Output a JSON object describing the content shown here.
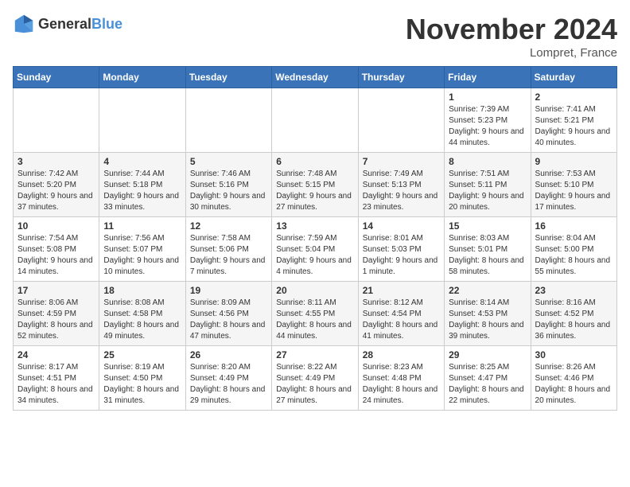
{
  "logo": {
    "text_general": "General",
    "text_blue": "Blue"
  },
  "header": {
    "month_title": "November 2024",
    "location": "Lompret, France"
  },
  "weekdays": [
    "Sunday",
    "Monday",
    "Tuesday",
    "Wednesday",
    "Thursday",
    "Friday",
    "Saturday"
  ],
  "weeks": [
    [
      {
        "day": "",
        "info": ""
      },
      {
        "day": "",
        "info": ""
      },
      {
        "day": "",
        "info": ""
      },
      {
        "day": "",
        "info": ""
      },
      {
        "day": "",
        "info": ""
      },
      {
        "day": "1",
        "info": "Sunrise: 7:39 AM\nSunset: 5:23 PM\nDaylight: 9 hours\nand 44 minutes."
      },
      {
        "day": "2",
        "info": "Sunrise: 7:41 AM\nSunset: 5:21 PM\nDaylight: 9 hours\nand 40 minutes."
      }
    ],
    [
      {
        "day": "3",
        "info": "Sunrise: 7:42 AM\nSunset: 5:20 PM\nDaylight: 9 hours\nand 37 minutes."
      },
      {
        "day": "4",
        "info": "Sunrise: 7:44 AM\nSunset: 5:18 PM\nDaylight: 9 hours\nand 33 minutes."
      },
      {
        "day": "5",
        "info": "Sunrise: 7:46 AM\nSunset: 5:16 PM\nDaylight: 9 hours\nand 30 minutes."
      },
      {
        "day": "6",
        "info": "Sunrise: 7:48 AM\nSunset: 5:15 PM\nDaylight: 9 hours\nand 27 minutes."
      },
      {
        "day": "7",
        "info": "Sunrise: 7:49 AM\nSunset: 5:13 PM\nDaylight: 9 hours\nand 23 minutes."
      },
      {
        "day": "8",
        "info": "Sunrise: 7:51 AM\nSunset: 5:11 PM\nDaylight: 9 hours\nand 20 minutes."
      },
      {
        "day": "9",
        "info": "Sunrise: 7:53 AM\nSunset: 5:10 PM\nDaylight: 9 hours\nand 17 minutes."
      }
    ],
    [
      {
        "day": "10",
        "info": "Sunrise: 7:54 AM\nSunset: 5:08 PM\nDaylight: 9 hours\nand 14 minutes."
      },
      {
        "day": "11",
        "info": "Sunrise: 7:56 AM\nSunset: 5:07 PM\nDaylight: 9 hours\nand 10 minutes."
      },
      {
        "day": "12",
        "info": "Sunrise: 7:58 AM\nSunset: 5:06 PM\nDaylight: 9 hours\nand 7 minutes."
      },
      {
        "day": "13",
        "info": "Sunrise: 7:59 AM\nSunset: 5:04 PM\nDaylight: 9 hours\nand 4 minutes."
      },
      {
        "day": "14",
        "info": "Sunrise: 8:01 AM\nSunset: 5:03 PM\nDaylight: 9 hours\nand 1 minute."
      },
      {
        "day": "15",
        "info": "Sunrise: 8:03 AM\nSunset: 5:01 PM\nDaylight: 8 hours\nand 58 minutes."
      },
      {
        "day": "16",
        "info": "Sunrise: 8:04 AM\nSunset: 5:00 PM\nDaylight: 8 hours\nand 55 minutes."
      }
    ],
    [
      {
        "day": "17",
        "info": "Sunrise: 8:06 AM\nSunset: 4:59 PM\nDaylight: 8 hours\nand 52 minutes."
      },
      {
        "day": "18",
        "info": "Sunrise: 8:08 AM\nSunset: 4:58 PM\nDaylight: 8 hours\nand 49 minutes."
      },
      {
        "day": "19",
        "info": "Sunrise: 8:09 AM\nSunset: 4:56 PM\nDaylight: 8 hours\nand 47 minutes."
      },
      {
        "day": "20",
        "info": "Sunrise: 8:11 AM\nSunset: 4:55 PM\nDaylight: 8 hours\nand 44 minutes."
      },
      {
        "day": "21",
        "info": "Sunrise: 8:12 AM\nSunset: 4:54 PM\nDaylight: 8 hours\nand 41 minutes."
      },
      {
        "day": "22",
        "info": "Sunrise: 8:14 AM\nSunset: 4:53 PM\nDaylight: 8 hours\nand 39 minutes."
      },
      {
        "day": "23",
        "info": "Sunrise: 8:16 AM\nSunset: 4:52 PM\nDaylight: 8 hours\nand 36 minutes."
      }
    ],
    [
      {
        "day": "24",
        "info": "Sunrise: 8:17 AM\nSunset: 4:51 PM\nDaylight: 8 hours\nand 34 minutes."
      },
      {
        "day": "25",
        "info": "Sunrise: 8:19 AM\nSunset: 4:50 PM\nDaylight: 8 hours\nand 31 minutes."
      },
      {
        "day": "26",
        "info": "Sunrise: 8:20 AM\nSunset: 4:49 PM\nDaylight: 8 hours\nand 29 minutes."
      },
      {
        "day": "27",
        "info": "Sunrise: 8:22 AM\nSunset: 4:49 PM\nDaylight: 8 hours\nand 27 minutes."
      },
      {
        "day": "28",
        "info": "Sunrise: 8:23 AM\nSunset: 4:48 PM\nDaylight: 8 hours\nand 24 minutes."
      },
      {
        "day": "29",
        "info": "Sunrise: 8:25 AM\nSunset: 4:47 PM\nDaylight: 8 hours\nand 22 minutes."
      },
      {
        "day": "30",
        "info": "Sunrise: 8:26 AM\nSunset: 4:46 PM\nDaylight: 8 hours\nand 20 minutes."
      }
    ]
  ]
}
